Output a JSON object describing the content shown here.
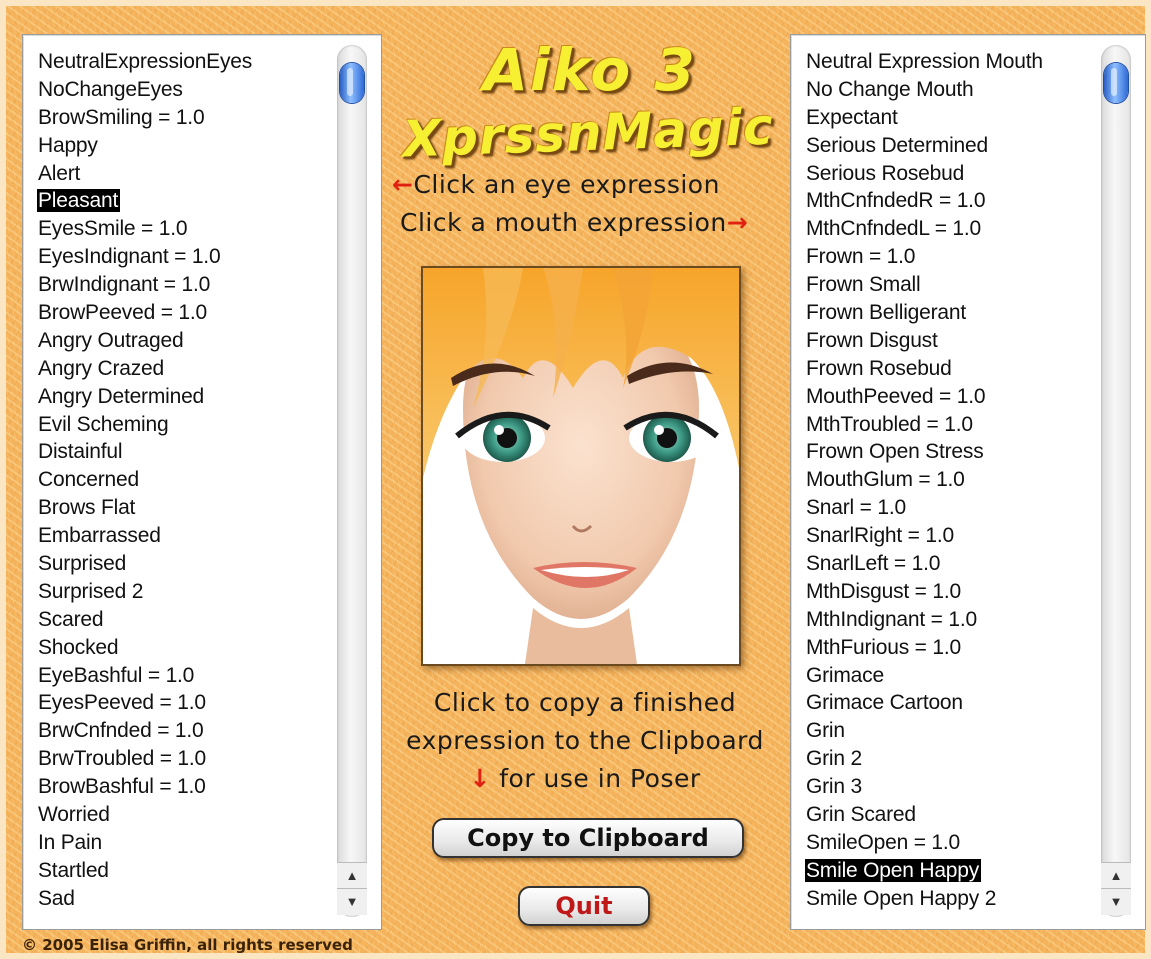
{
  "app": {
    "title_line1": "Aiko 3",
    "title_line2": "XprssnMagic"
  },
  "instructions": {
    "eye": "Click an eye expression",
    "mouth": "Click a mouth expression",
    "left_arrow": "←",
    "right_arrow": "→",
    "down_arrow": "↓",
    "copy_line1": "Click to copy a finished",
    "copy_line2": "expression to the Clipboard",
    "copy_line3": "for use in Poser"
  },
  "buttons": {
    "copy": "Copy to Clipboard",
    "quit": "Quit"
  },
  "copyright": "© 2005 Elisa Griffin, all rights reserved",
  "eye_list": {
    "selected": "Pleasant",
    "items": [
      "NeutralExpressionEyes",
      "NoChangeEyes",
      "BrowSmiling = 1.0",
      "Happy",
      "Alert",
      "Pleasant",
      "EyesSmile = 1.0",
      "EyesIndignant = 1.0",
      "BrwIndignant = 1.0",
      "BrowPeeved = 1.0",
      "Angry Outraged",
      "Angry Crazed",
      "Angry Determined",
      "Evil Scheming",
      "Distainful",
      "Concerned",
      "Brows Flat",
      "Embarrassed",
      "Surprised",
      "Surprised 2",
      "Scared",
      "Shocked",
      "EyeBashful = 1.0",
      "EyesPeeved = 1.0",
      "BrwCnfnded = 1.0",
      "BrwTroubled = 1.0",
      "BrowBashful = 1.0",
      "Worried",
      "In Pain",
      "Startled",
      "Sad"
    ]
  },
  "mouth_list": {
    "selected": "Smile Open Happy",
    "items": [
      "Neutral Expression Mouth",
      "No Change Mouth",
      "Expectant",
      "Serious Determined",
      "Serious Rosebud",
      "MthCnfndedR = 1.0",
      "MthCnfndedL = 1.0",
      "Frown = 1.0",
      "Frown Small",
      "Frown Belligerant",
      "Frown Disgust",
      "Frown Rosebud",
      "MouthPeeved = 1.0",
      "MthTroubled = 1.0",
      "Frown Open Stress",
      "MouthGlum = 1.0",
      "Snarl = 1.0",
      "SnarlRight = 1.0",
      "SnarlLeft = 1.0",
      "MthDisgust = 1.0",
      "MthIndignant = 1.0",
      "MthFurious = 1.0",
      "Grimace",
      "Grimace Cartoon",
      "Grin",
      "Grin 2",
      "Grin 3",
      "Grin Scared",
      "SmileOpen = 1.0",
      "Smile Open Happy",
      "Smile Open Happy 2"
    ]
  },
  "colors": {
    "title": "#f6ef32",
    "arrow": "#e02010",
    "quit_text": "#c01818",
    "scroll_thumb": "#2f6ad6"
  },
  "icons": {
    "scroll_up": "triangle-up-icon",
    "scroll_down": "triangle-down-icon"
  }
}
